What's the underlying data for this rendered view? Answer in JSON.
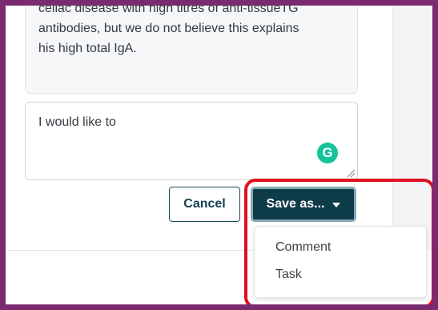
{
  "thread": {
    "quote_lines": [
      "celiac disease with high titres of anti-tissueTG",
      "antibodies, but we do not believe this explains",
      "his high total IgA."
    ]
  },
  "compose": {
    "value": "I would like to",
    "grammarly_letter": "G"
  },
  "actions": {
    "cancel_label": "Cancel",
    "save_label": "Save as..."
  },
  "save_menu": {
    "items": [
      "Comment",
      "Task"
    ]
  },
  "colors": {
    "frame": "#7a2a6f",
    "primary_button": "#0e3b48",
    "highlight": "#e0101f",
    "grammarly": "#15c39a"
  }
}
